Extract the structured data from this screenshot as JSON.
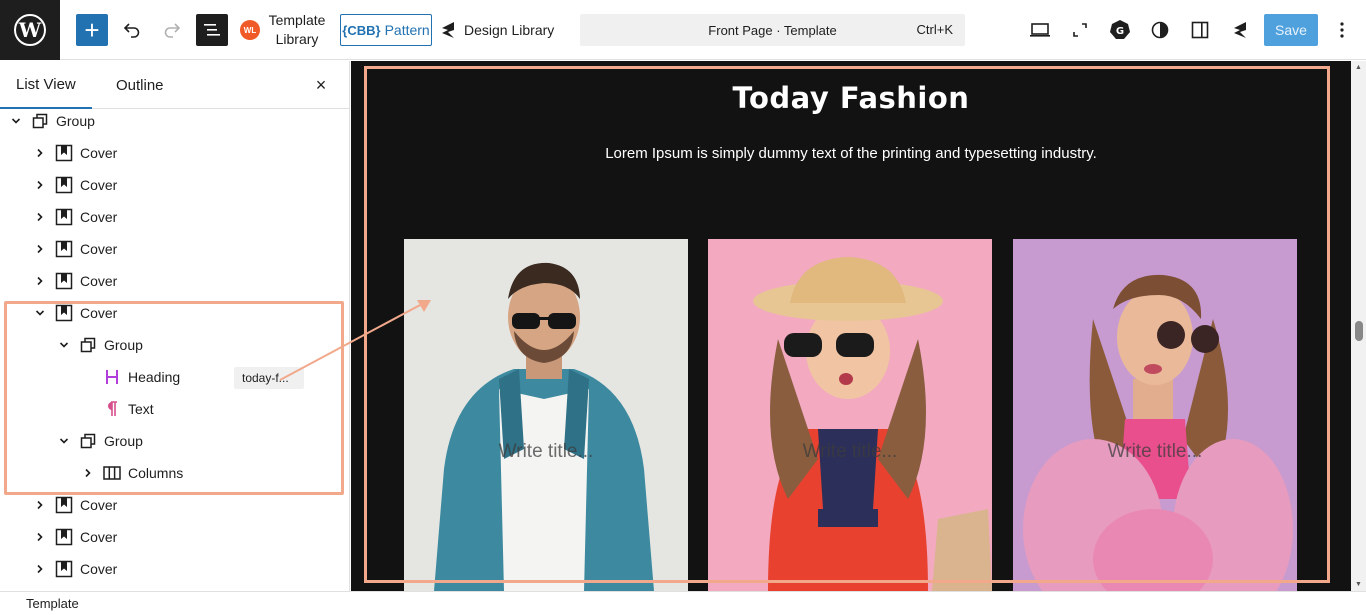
{
  "toolbar": {
    "template_library_label": "Template Library",
    "template_library_icon_text": "WL",
    "pattern_prefix": "{CBB}",
    "pattern_label": "Pattern",
    "design_library_label": "Design Library",
    "document_title": "Front Page · Template",
    "shortcut": "Ctrl+K",
    "save_label": "Save",
    "add_symbol": "+",
    "accent_color": "#2271b1"
  },
  "sidebar": {
    "tabs": [
      {
        "label": "List View",
        "active": true
      },
      {
        "label": "Outline",
        "active": false
      }
    ],
    "close_symbol": "×",
    "rows": [
      {
        "label": "Group",
        "type": "group",
        "expanded": true
      },
      {
        "label": "Cover",
        "type": "cover",
        "expanded": false
      },
      {
        "label": "Cover",
        "type": "cover",
        "expanded": false
      },
      {
        "label": "Cover",
        "type": "cover",
        "expanded": false
      },
      {
        "label": "Cover",
        "type": "cover",
        "expanded": false
      },
      {
        "label": "Cover",
        "type": "cover",
        "expanded": false
      },
      {
        "label": "Cover",
        "type": "cover",
        "expanded": true
      },
      {
        "label": "Group",
        "type": "group",
        "expanded": true
      },
      {
        "label": "Heading",
        "type": "heading",
        "anchor": "today-f..."
      },
      {
        "label": "Text",
        "type": "paragraph"
      },
      {
        "label": "Group",
        "type": "group",
        "expanded": true
      },
      {
        "label": "Columns",
        "type": "columns",
        "expanded": false
      },
      {
        "label": "Cover",
        "type": "cover",
        "expanded": false
      },
      {
        "label": "Cover",
        "type": "cover",
        "expanded": false
      },
      {
        "label": "Cover",
        "type": "cover",
        "expanded": false
      }
    ]
  },
  "canvas": {
    "title": "Today Fashion",
    "subtitle": "Lorem Ipsum is simply dummy text of the printing and typesetting industry.",
    "cards": [
      {
        "title_placeholder": "Write title..."
      },
      {
        "title_placeholder": "Write title..."
      },
      {
        "title_placeholder": "Write title..."
      }
    ],
    "highlight_color": "#f1a88b"
  },
  "footer": {
    "breadcrumb": "Template"
  }
}
